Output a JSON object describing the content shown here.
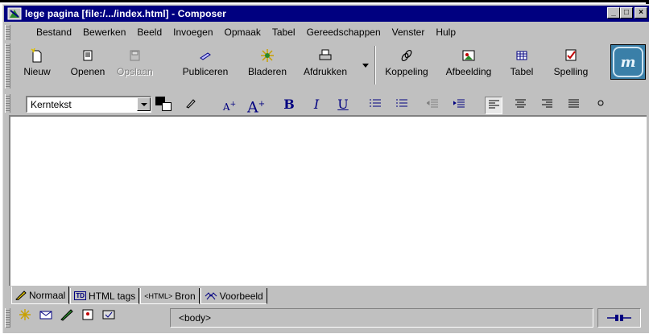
{
  "window": {
    "title": "lege pagina [file:/.../index.html] - Composer",
    "buttons": {
      "minimize": "_",
      "maximize": "□",
      "close": "×"
    }
  },
  "menu": [
    {
      "label": "Bestand"
    },
    {
      "label": "Bewerken"
    },
    {
      "label": "Beeld"
    },
    {
      "label": "Invoegen"
    },
    {
      "label": "Opmaak"
    },
    {
      "label": "Tabel"
    },
    {
      "label": "Gereedschappen"
    },
    {
      "label": "Venster"
    },
    {
      "label": "Hulp"
    }
  ],
  "toolbar": {
    "new": "Nieuw",
    "open": "Openen",
    "save": "Opslaan",
    "publish": "Publiceren",
    "browse": "Bladeren",
    "print": "Afdrukken",
    "link": "Koppeling",
    "image": "Afbeelding",
    "table": "Tabel",
    "spelling": "Spelling"
  },
  "format": {
    "paragraph_style": "Kerntekst",
    "bold": "B",
    "italic": "I",
    "underline": "U",
    "font_smaller": "A",
    "font_larger": "A"
  },
  "modes": [
    {
      "label": "Normaal",
      "active": true
    },
    {
      "label": "HTML tags",
      "badge": "TD"
    },
    {
      "label": "Bron",
      "badge": "<HTML>"
    },
    {
      "label": "Voorbeeld"
    }
  ],
  "status": {
    "text": "<body>"
  },
  "colors": {
    "titlebar": "#000080",
    "chrome": "#c0c0c0",
    "logo": "#3a7fa8"
  }
}
